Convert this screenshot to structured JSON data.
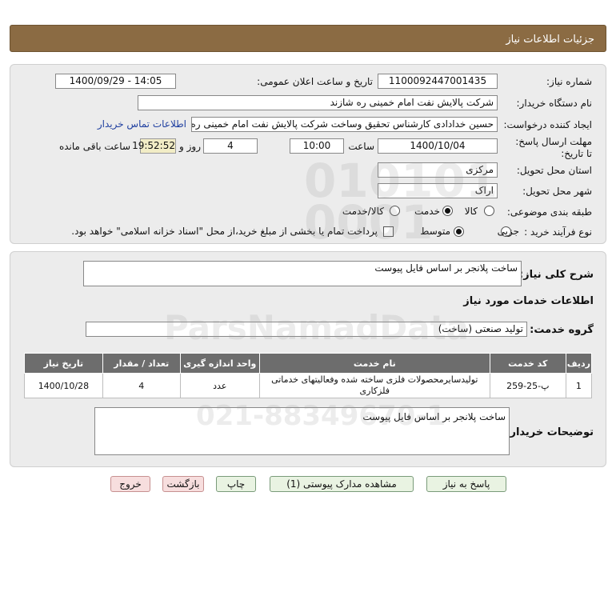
{
  "header": {
    "title": "جزئیات اطلاعات نیاز"
  },
  "details": {
    "need_number_label": "شماره نیاز:",
    "need_number": "1100092447001435",
    "announce_label": "تاریخ و ساعت اعلان عمومی:",
    "announce_value": "1400/09/29 - 14:05",
    "buyer_org_label": "نام دستگاه خریدار:",
    "buyer_org": "شرکت پالایش نفت امام خمینی  ره  شازند",
    "creator_label": "ایجاد کننده درخواست:",
    "creator": "حسین خدادادی کارشناس تحقیق وساخت شرکت پالایش نفت امام خمینی  ره",
    "contact_link": "اطلاعات تماس خریدار",
    "deadline_label": "مهلت ارسال پاسخ: تا تاریخ:",
    "deadline_date": "1400/10/04",
    "time_label": "ساعت",
    "deadline_time": "10:00",
    "days_value": "4",
    "days_label": "روز و",
    "remaining_time": "19:52:52",
    "remaining_label": "ساعت باقی مانده",
    "province_label": "استان محل تحویل:",
    "province": "مرکزی",
    "city_label": "شهر محل تحویل:",
    "city": "اراک",
    "category_label": "طبقه بندی موضوعی:",
    "category_options": [
      "کالا",
      "خدمت",
      "کالا/خدمت"
    ],
    "category_selected": "خدمت",
    "process_label": "نوع فرآیند خرید :",
    "process_options": [
      "جزیی",
      "متوسط"
    ],
    "process_selected": "متوسط",
    "payment_note": "پرداخت تمام یا بخشی از مبلغ خرید،از محل \"اسناد خزانه اسلامی\" خواهد بود."
  },
  "summary": {
    "general_desc_label": "شرح کلی نیاز:",
    "general_desc": "ساخت پلانجر بر اساس فایل پیوست",
    "services_heading": "اطلاعات خدمات مورد نیاز",
    "service_group_label": "گروه خدمت:",
    "service_group": "تولید صنعتی (ساخت)",
    "table": {
      "columns": [
        "ردیف",
        "کد خدمت",
        "نام خدمت",
        "واحد اندازه گیری",
        "تعداد / مقدار",
        "تاریخ نیاز"
      ],
      "rows": [
        [
          "1",
          "پ-25-259",
          "تولیدسایرمحصولات فلزی ساخته شده وفعالیتهای خدماتی فلزکاری",
          "عدد",
          "4",
          "1400/10/28"
        ]
      ]
    },
    "buyer_notes_label": "توضیحات خریدار:",
    "buyer_notes": "ساخت پلانجر بر اساس فایل پیوست"
  },
  "buttons": {
    "reply": "پاسخ به نیاز",
    "view_docs": "مشاهده مدارک پیوستی (1)",
    "print": "چاپ",
    "back": "بازگشت",
    "exit": "خروج"
  }
}
